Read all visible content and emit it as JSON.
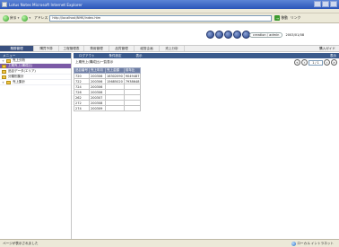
{
  "window": {
    "title": "Lotus Notes Microsoft Internet Explorer"
  },
  "toolbar": {
    "back_label": "戻る",
    "address_label": "アドレス",
    "address_value": "http://localhost/NHK/index.htm",
    "go_label": "移動",
    "links_label": "リンク"
  },
  "header": {
    "user_label": "creation / admin",
    "date_label": "2003/01/08"
  },
  "navbar": {
    "tabs": [
      "業務管理",
      "購買予算",
      "工程管理表",
      "費用管理",
      "品質管理",
      "経営企画",
      "売上分析"
    ],
    "right_label": "購入ガイド"
  },
  "leftpanel": {
    "header": "メニュー",
    "items": [
      {
        "label": "売上分析",
        "level": 0,
        "selected": false
      },
      {
        "label": "上期売上(構成比)",
        "level": 0,
        "selected": true
      },
      {
        "label": "品目データ(エリア)",
        "level": 0,
        "selected": false
      },
      {
        "label": "分類別集計",
        "level": 0,
        "selected": false
      },
      {
        "label": "売上集計",
        "level": 0,
        "selected": false
      }
    ]
  },
  "content": {
    "tabs": [
      "ログアウト",
      "条件設定",
      "表示"
    ],
    "tab_right": "表示",
    "subtitle": "上期売上(構成比)一覧表示",
    "page_input": "1 / 1"
  },
  "table": {
    "headers": [
      "品目番号",
      "売上年月",
      "売上金額",
      "前年比"
    ],
    "rows": [
      [
        "720",
        "200306",
        "16302090",
        "9049487"
      ],
      [
        "722",
        "200306",
        "15685020",
        "7938648"
      ],
      [
        "724",
        "200306",
        "",
        ""
      ],
      [
        "726",
        "200306",
        "",
        ""
      ],
      [
        "262",
        "200307",
        "",
        ""
      ],
      [
        "272",
        "200308",
        "",
        ""
      ],
      [
        "274",
        "200309",
        "",
        ""
      ]
    ]
  },
  "statusbar": {
    "left": "ページが表示されました",
    "zone": "ローカル イントラネット"
  }
}
